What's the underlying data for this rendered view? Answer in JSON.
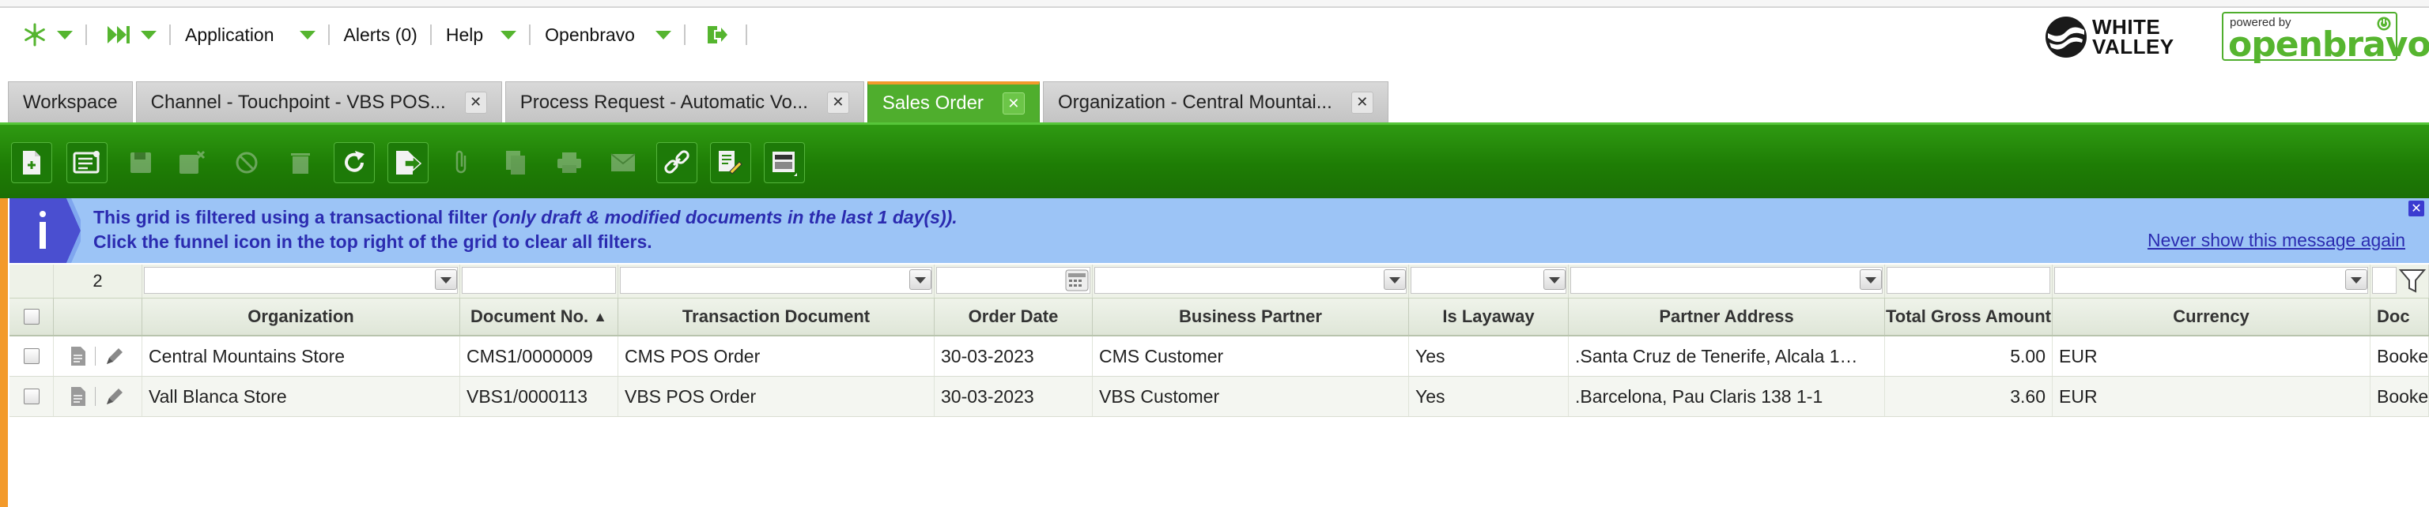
{
  "topnav": {
    "menus": [
      {
        "label": "Application"
      },
      {
        "label": "Alerts (0)"
      },
      {
        "label": "Help"
      },
      {
        "label": "Openbravo"
      }
    ]
  },
  "logos": {
    "white_valley": "WHITE VALLEY",
    "powered_by": "powered by",
    "openbravo": "openbravo"
  },
  "tabs": [
    {
      "label": "Workspace",
      "active": false
    },
    {
      "label": "Channel - Touchpoint - VBS POS...",
      "active": false
    },
    {
      "label": "Process Request - Automatic Vo...",
      "active": false
    },
    {
      "label": "Sales Order",
      "active": true
    },
    {
      "label": "Organization - Central Mountai...",
      "active": false
    }
  ],
  "toolbar": {
    "buttons": [
      {
        "icon": "new-document-icon",
        "enabled": true
      },
      {
        "icon": "form-view-icon",
        "enabled": true
      },
      {
        "icon": "save-icon",
        "enabled": false
      },
      {
        "icon": "save-close-icon",
        "enabled": false
      },
      {
        "icon": "cancel-icon",
        "enabled": false
      },
      {
        "icon": "delete-icon",
        "enabled": false
      },
      {
        "icon": "refresh-icon",
        "enabled": true
      },
      {
        "icon": "export-icon",
        "enabled": true
      },
      {
        "icon": "attach-icon",
        "enabled": false
      },
      {
        "icon": "copy-icon",
        "enabled": false
      },
      {
        "icon": "print-icon",
        "enabled": false
      },
      {
        "icon": "email-icon",
        "enabled": false
      },
      {
        "icon": "link-icon",
        "enabled": true
      },
      {
        "icon": "tools-icon",
        "enabled": true
      },
      {
        "icon": "layout-icon",
        "enabled": true
      }
    ]
  },
  "message": {
    "line1_prefix": "This grid is filtered using a transactional filter ",
    "line1_italic": "(only draft & modified documents in the last 1 day(s)).",
    "line2": "Click the funnel icon in the top right of the grid to clear all filters.",
    "never_show": "Never show this message again"
  },
  "grid": {
    "row_count": "2",
    "columns": [
      {
        "label": "",
        "key": "check"
      },
      {
        "label": "",
        "key": "actions"
      },
      {
        "label": "Organization",
        "key": "organization"
      },
      {
        "label": "Document No.",
        "key": "document_no",
        "sort": "▲"
      },
      {
        "label": "Transaction Document",
        "key": "transaction_document"
      },
      {
        "label": "Order Date",
        "key": "order_date"
      },
      {
        "label": "Business Partner",
        "key": "business_partner"
      },
      {
        "label": "Is Layaway",
        "key": "is_layaway"
      },
      {
        "label": "Partner Address",
        "key": "partner_address"
      },
      {
        "label": "Total Gross Amount",
        "key": "total_gross_amount"
      },
      {
        "label": "Currency",
        "key": "currency"
      },
      {
        "label": "Doc",
        "key": "doc_status"
      }
    ],
    "rows": [
      {
        "organization": "Central Mountains Store",
        "document_no": "CMS1/0000009",
        "transaction_document": "CMS POS Order",
        "order_date": "30-03-2023",
        "business_partner": "CMS Customer",
        "is_layaway": "Yes",
        "partner_address": ".Santa Cruz de Tenerife, Alcala 1…",
        "total_gross_amount": "5.00",
        "currency": "EUR",
        "doc_status": "Booke"
      },
      {
        "organization": "Vall Blanca Store",
        "document_no": "VBS1/0000113",
        "transaction_document": "VBS POS Order",
        "order_date": "30-03-2023",
        "business_partner": "VBS Customer",
        "is_layaway": "Yes",
        "partner_address": ".Barcelona, Pau Claris 138 1-1",
        "total_gross_amount": "3.60",
        "currency": "EUR",
        "doc_status": "Booke"
      }
    ]
  },
  "colors": {
    "accent_green": "#4fae2d",
    "toolbar_green": "#1e7d05",
    "tab_active_top": "#f39a2b",
    "message_bg": "#9cc4f6",
    "message_text": "#2b2bb0"
  }
}
